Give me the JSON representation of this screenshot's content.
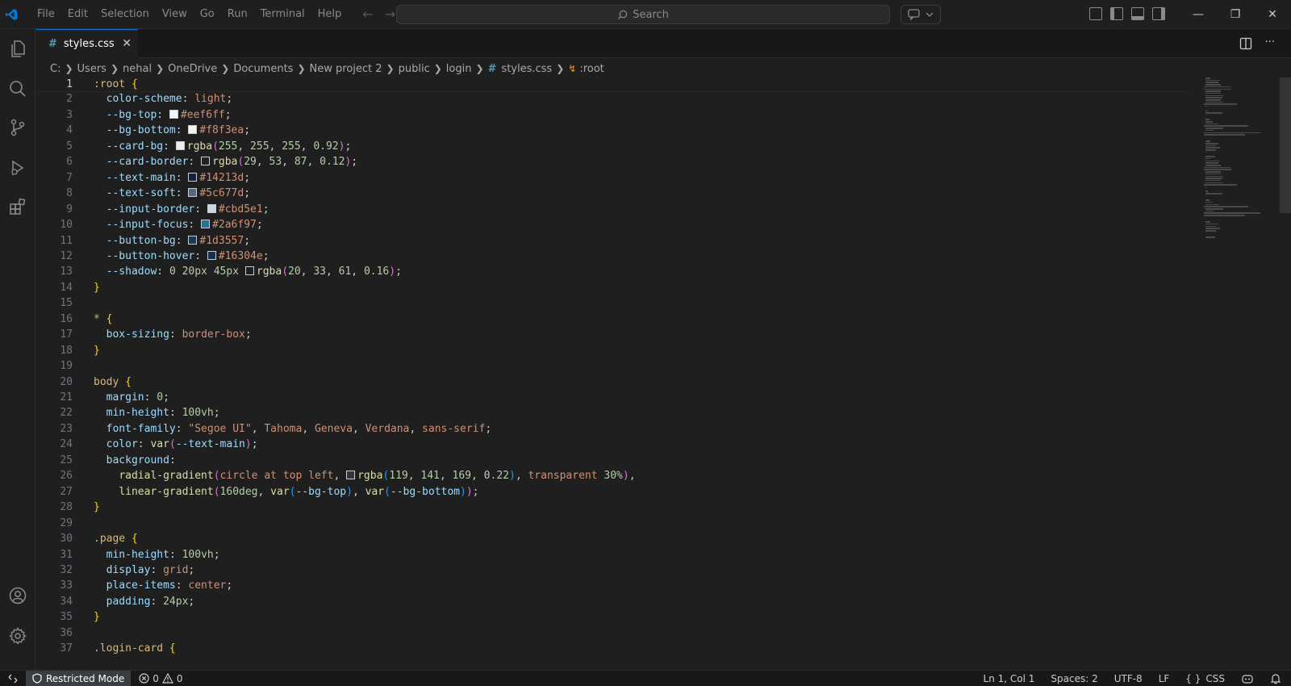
{
  "menu": [
    "File",
    "Edit",
    "Selection",
    "View",
    "Go",
    "Run",
    "Terminal",
    "Help"
  ],
  "search": {
    "placeholder": "Search"
  },
  "tab": {
    "label": "styles.css"
  },
  "breadcrumb": [
    "C:",
    "Users",
    "nehal",
    "OneDrive",
    "Documents",
    "New project 2",
    "public",
    "login",
    "styles.css",
    ":root"
  ],
  "colors": {
    "accent": "#0078d4",
    "css_icon": "#519aba"
  },
  "code_lines": [
    {
      "n": "1",
      "text": ":root {"
    },
    {
      "n": "2",
      "text": "color-scheme: light;"
    },
    {
      "n": "3",
      "text": "--bg-top: #eef6ff;"
    },
    {
      "n": "4",
      "text": "--bg-bottom: #f8f3ea;"
    },
    {
      "n": "5",
      "text": "--card-bg: rgba(255, 255, 255, 0.92);"
    },
    {
      "n": "6",
      "text": "--card-border: rgba(29, 53, 87, 0.12);"
    },
    {
      "n": "7",
      "text": "--text-main: #14213d;"
    },
    {
      "n": "8",
      "text": "--text-soft: #5c677d;"
    },
    {
      "n": "9",
      "text": "--input-border: #cbd5e1;"
    },
    {
      "n": "10",
      "text": "--input-focus: #2a6f97;"
    },
    {
      "n": "11",
      "text": "--button-bg: #1d3557;"
    },
    {
      "n": "12",
      "text": "--button-hover: #16304e;"
    },
    {
      "n": "13",
      "text": "--shadow: 0 20px 45px rgba(20, 33, 61, 0.16);"
    },
    {
      "n": "14",
      "text": "}"
    },
    {
      "n": "15",
      "text": ""
    },
    {
      "n": "16",
      "text": "* {"
    },
    {
      "n": "17",
      "text": "box-sizing: border-box;"
    },
    {
      "n": "18",
      "text": "}"
    },
    {
      "n": "19",
      "text": ""
    },
    {
      "n": "20",
      "text": "body {"
    },
    {
      "n": "21",
      "text": "margin: 0;"
    },
    {
      "n": "22",
      "text": "min-height: 100vh;"
    },
    {
      "n": "23",
      "text": "font-family: \"Segoe UI\", Tahoma, Geneva, Verdana, sans-serif;"
    },
    {
      "n": "24",
      "text": "color: var(--text-main);"
    },
    {
      "n": "25",
      "text": "background:"
    },
    {
      "n": "26",
      "text": "radial-gradient(circle at top left, rgba(119, 141, 169, 0.22), transparent 30%),"
    },
    {
      "n": "27",
      "text": "linear-gradient(160deg, var(--bg-top), var(--bg-bottom));"
    },
    {
      "n": "28",
      "text": "}"
    },
    {
      "n": "29",
      "text": ""
    },
    {
      "n": "30",
      "text": ".page {"
    },
    {
      "n": "31",
      "text": "min-height: 100vh;"
    },
    {
      "n": "32",
      "text": "display: grid;"
    },
    {
      "n": "33",
      "text": "place-items: center;"
    },
    {
      "n": "34",
      "text": "padding: 24px;"
    },
    {
      "n": "35",
      "text": "}"
    },
    {
      "n": "36",
      "text": ""
    },
    {
      "n": "37",
      "text": ".login-card {"
    }
  ],
  "status": {
    "restricted": "Restricted Mode",
    "errors": "0",
    "warnings": "0",
    "position": "Ln 1, Col 1",
    "spaces": "Spaces: 2",
    "encoding": "UTF-8",
    "eol": "LF",
    "language": "CSS"
  }
}
